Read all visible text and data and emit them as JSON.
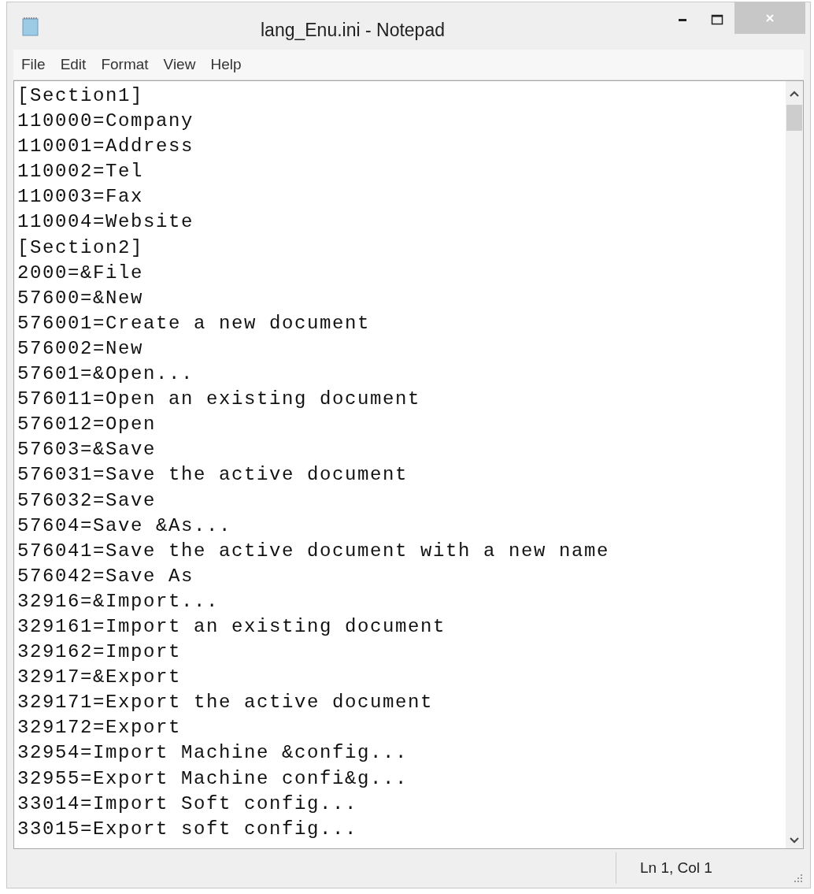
{
  "window": {
    "title": "lang_Enu.ini - Notepad"
  },
  "menu": [
    {
      "label": "File"
    },
    {
      "label": "Edit"
    },
    {
      "label": "Format"
    },
    {
      "label": "View"
    },
    {
      "label": "Help"
    }
  ],
  "editor": {
    "lines": [
      "[Section1]",
      "110000=Company",
      "110001=Address",
      "110002=Tel",
      "110003=Fax",
      "110004=Website",
      "[Section2]",
      "2000=&File",
      "57600=&New",
      "576001=Create a new document",
      "576002=New",
      "57601=&Open...",
      "576011=Open an existing document",
      "576012=Open",
      "57603=&Save",
      "576031=Save the active document",
      "576032=Save",
      "57604=Save &As...",
      "576041=Save the active document with a new name",
      "576042=Save As",
      "32916=&Import...",
      "329161=Import an existing document",
      "329162=Import",
      "32917=&Export",
      "329171=Export the active document",
      "329172=Export",
      "32954=Import Machine &config...",
      "32955=Export Machine confi&g...",
      "33014=Import Soft config...",
      "33015=Export soft config..."
    ]
  },
  "status_bar": {
    "position": "Ln 1, Col 1"
  }
}
